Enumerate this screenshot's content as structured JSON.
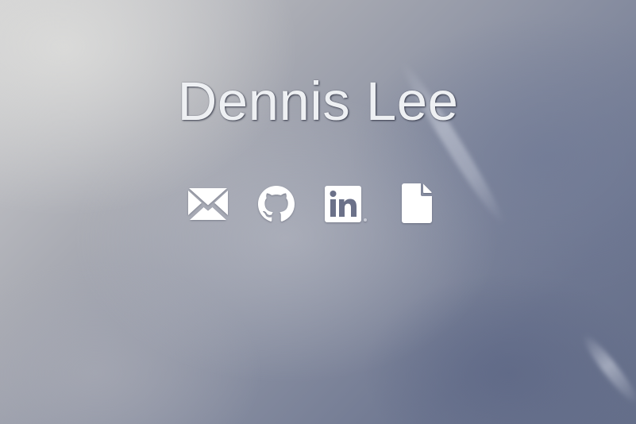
{
  "profile": {
    "name": "Dennis Lee"
  },
  "social_links": [
    {
      "icon": "email-icon"
    },
    {
      "icon": "github-icon"
    },
    {
      "icon": "linkedin-icon"
    },
    {
      "icon": "document-icon"
    }
  ],
  "colors": {
    "name_text": "#eef0f3",
    "icon_fill": "#ffffff",
    "sky_light": "#cfcfd0",
    "sky_dark": "#646e89"
  }
}
